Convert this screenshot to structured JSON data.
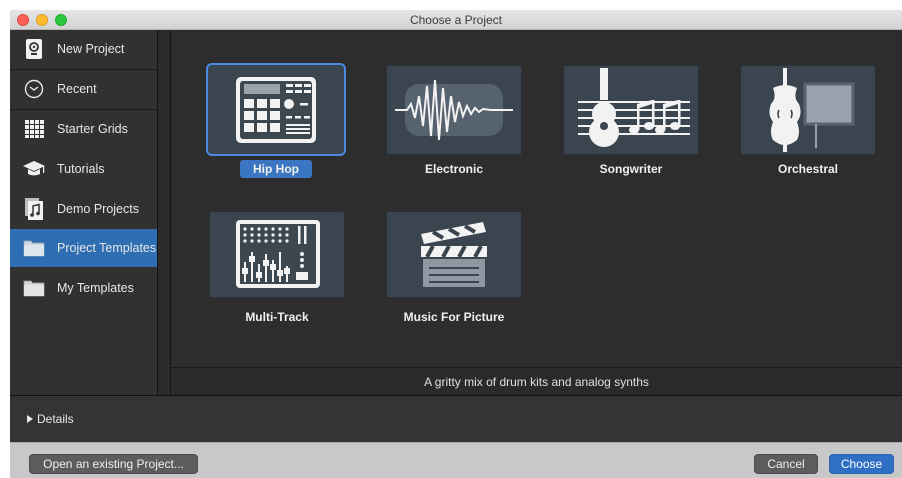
{
  "window": {
    "title": "Choose a Project"
  },
  "sidebar": {
    "items": [
      {
        "label": "New Project",
        "icon": "new-project-icon"
      },
      {
        "label": "Recent",
        "icon": "clock-icon"
      },
      {
        "label": "Starter Grids",
        "icon": "grid-icon"
      },
      {
        "label": "Tutorials",
        "icon": "graduation-cap-icon"
      },
      {
        "label": "Demo Projects",
        "icon": "music-note-icon"
      },
      {
        "label": "Project Templates",
        "icon": "folder-icon",
        "selected": true
      },
      {
        "label": "My Templates",
        "icon": "folder-icon"
      }
    ]
  },
  "templates": [
    {
      "label": "Hip Hop",
      "icon": "drum-machine-icon",
      "selected": true
    },
    {
      "label": "Electronic",
      "icon": "waveform-icon"
    },
    {
      "label": "Songwriter",
      "icon": "guitar-notes-icon"
    },
    {
      "label": "Orchestral",
      "icon": "violin-icon"
    },
    {
      "label": "Multi-Track",
      "icon": "mixer-icon"
    },
    {
      "label": "Music For Picture",
      "icon": "clapperboard-icon"
    }
  ],
  "description": "A gritty mix of drum kits and analog synths",
  "details": {
    "label": "Details"
  },
  "footer": {
    "open_existing": "Open an existing Project...",
    "cancel": "Cancel",
    "choose": "Choose"
  },
  "colors": {
    "accent": "#2f6fc4",
    "selection": "#2f6db3"
  }
}
